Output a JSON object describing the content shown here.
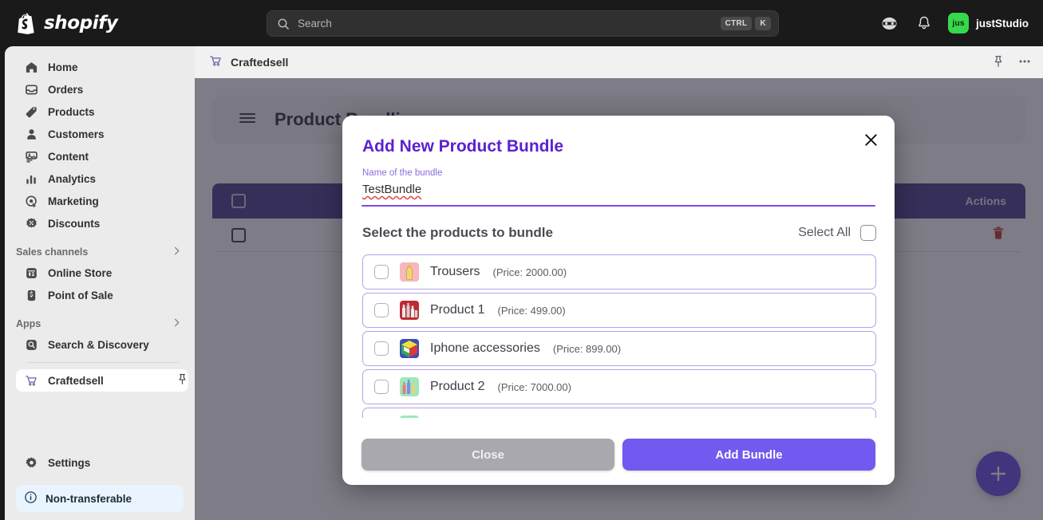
{
  "topbar": {
    "brand": "shopify",
    "brand_icon": "shopify-bag-icon",
    "search": {
      "placeholder": "Search",
      "icon": "search-icon",
      "kbd1": "CTRL",
      "kbd2": "K"
    },
    "help_icon": "help-face-icon",
    "bell_icon": "notification-bell-icon",
    "user": {
      "initials": "jus",
      "name": "justStudio",
      "avatar_color": "#36d94b"
    }
  },
  "sidebar": {
    "items": [
      {
        "label": "Home",
        "icon": "home-icon"
      },
      {
        "label": "Orders",
        "icon": "orders-inbox-icon"
      },
      {
        "label": "Products",
        "icon": "product-tag-icon"
      },
      {
        "label": "Customers",
        "icon": "customer-person-icon"
      },
      {
        "label": "Content",
        "icon": "content-image-icon"
      },
      {
        "label": "Analytics",
        "icon": "analytics-bars-icon"
      },
      {
        "label": "Marketing",
        "icon": "marketing-target-icon"
      },
      {
        "label": "Discounts",
        "icon": "discount-badge-icon"
      }
    ],
    "sales_channels": {
      "label": "Sales channels",
      "chevron": "chevron-right-icon"
    },
    "channels": [
      {
        "label": "Online Store",
        "icon": "online-store-icon"
      },
      {
        "label": "Point of Sale",
        "icon": "point-of-sale-icon"
      }
    ],
    "apps_section": {
      "label": "Apps",
      "chevron": "chevron-right-icon"
    },
    "apps": [
      {
        "label": "Search & Discovery",
        "icon": "search-discovery-icon",
        "active": false
      },
      {
        "label": "Craftedsell",
        "icon": "cart-icon",
        "active": true,
        "pin": "pin-icon"
      }
    ],
    "settings": {
      "label": "Settings",
      "icon": "gear-icon"
    },
    "non_transferable": {
      "label": "Non-transferable",
      "icon": "info-circle-icon"
    }
  },
  "appbar": {
    "title": "Craftedsell",
    "icon": "cart-icon",
    "pin_icon": "pin-icon",
    "more_icon": "more-horizontal-icon"
  },
  "page": {
    "title": "Product Bundling",
    "menu_icon": "hamburger-menu-icon",
    "table": {
      "header_actions": "Actions",
      "row_delete_icon": "trash-icon"
    },
    "fab_icon": "plus-icon"
  },
  "modal": {
    "title": "Add New Product Bundle",
    "close_icon": "close-x-icon",
    "field_label": "Name of the bundle",
    "field_value": "TestBundle",
    "select_heading": "Select the products to bundle",
    "select_all_label": "Select All",
    "products": [
      {
        "name": "Trousers",
        "price": "(Price: 2000.00)",
        "thumb_bg": "#f6b8bd",
        "thumb_icon": "bottle-thumbnail"
      },
      {
        "name": "Product 1",
        "price": "(Price: 499.00)",
        "thumb_bg": "#c02a32",
        "thumb_icon": "bottles-thumbnail"
      },
      {
        "name": "Iphone accessories",
        "price": "(Price: 899.00)",
        "thumb_bg": "#3b4fb8",
        "thumb_icon": "colorcube-thumbnail"
      },
      {
        "name": "Product 2",
        "price": "(Price: 7000.00)",
        "thumb_bg": "#9fe8b8",
        "thumb_icon": "bottles2-thumbnail"
      },
      {
        "name": "",
        "price": "",
        "thumb_bg": "#9fe8b8",
        "thumb_icon": "partial-thumbnail"
      }
    ],
    "close_button": "Close",
    "add_button": "Add Bundle"
  },
  "colors": {
    "accent_purple": "#7259ef",
    "title_purple": "#5b21cf",
    "table_header": "#4b3f8f",
    "brand_green": "#36d94b"
  }
}
